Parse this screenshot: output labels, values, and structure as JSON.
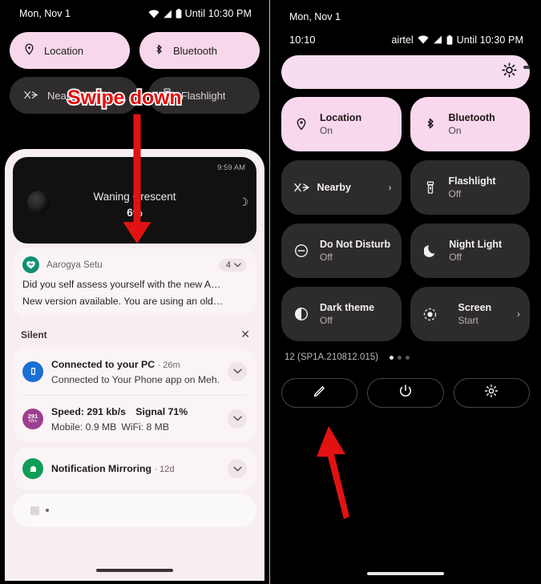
{
  "left_phone": {
    "statusbar": {
      "date": "Mon, Nov 1",
      "battery_text": "Until 10:30 PM",
      "icons": [
        "wifi-icon",
        "signal-icon",
        "battery-icon"
      ]
    },
    "quick_tiles": [
      {
        "label": "Location",
        "state": "on",
        "icon": "location-pin-icon"
      },
      {
        "label": "Bluetooth",
        "state": "on",
        "icon": "bluetooth-icon"
      },
      {
        "label": "Nearby Shar..",
        "state": "off",
        "icon": "nearby-share-icon",
        "chevron": "›"
      },
      {
        "label": "Flashlight",
        "state": "off",
        "icon": "flashlight-icon"
      }
    ],
    "moon_widget": {
      "time": "9:59 AM",
      "title": "Waning Crescent",
      "percent": "6%",
      "phase_glyph": "☽"
    },
    "notification_aarogya": {
      "app": "Aarogya Setu",
      "count": "4",
      "chevron": "⌄",
      "line1": "Did you self assess yourself with the new A…",
      "line2": "New version available. You are using an old…"
    },
    "silent_header": {
      "label": "Silent",
      "close": "✕"
    },
    "silent_rows": [
      {
        "title": "Connected to your PC",
        "time": "· 26m",
        "subtitle": "Connected to Your Phone app on Meh..",
        "icon": "phone-link-icon",
        "icon_color": "#1a6fd4",
        "chevron": "⌄"
      },
      {
        "title": "Speed: 291 kb/s Signal 71%",
        "time": "",
        "subtitle": "Mobile: 0.9 MB WiFi: 8 MB",
        "icon": "speed-meter-icon",
        "icon_color": "#9c3f8f",
        "icon_text": "291",
        "chevron": "⌄"
      },
      {
        "title": "Notification Mirroring",
        "time": "· 12d",
        "subtitle": "",
        "icon": "mirroring-icon",
        "icon_color": "#0f9d58",
        "chevron": "⌄"
      }
    ],
    "annotation": {
      "text": "Swipe down",
      "arrow": "down-arrow-annotation",
      "color": "#e21212"
    }
  },
  "right_phone": {
    "statusbar": {
      "date": "Mon, Nov 1",
      "clock": "10:10",
      "carrier": "airtel",
      "battery_text": "Until 10:30 PM"
    },
    "brightness": {
      "name": "brightness-slider",
      "icon": "brightness-sun-icon",
      "level_percent": 96
    },
    "tiles": [
      {
        "label": "Location",
        "state_label": "On",
        "state": "on",
        "icon": "location-pin-icon"
      },
      {
        "label": "Bluetooth",
        "state_label": "On",
        "state": "on",
        "icon": "bluetooth-icon"
      },
      {
        "label": "Nearby",
        "state_label": "",
        "state": "off",
        "icon": "nearby-share-icon",
        "chevron": "›",
        "centered": true
      },
      {
        "label": "Flashlight",
        "state_label": "Off",
        "state": "off",
        "icon": "flashlight-icon"
      },
      {
        "label": "Do Not Disturb",
        "state_label": "Off",
        "state": "off",
        "icon": "do-not-disturb-icon"
      },
      {
        "label": "Night Light",
        "state_label": "Off",
        "state": "off",
        "icon": "moon-icon"
      },
      {
        "label": "Dark theme",
        "state_label": "Off",
        "state": "off",
        "icon": "contrast-icon"
      },
      {
        "label": "Screen",
        "state_label": "Start",
        "state": "off",
        "icon": "screen-record-icon",
        "chevron": "›",
        "centered": true
      }
    ],
    "build": "12 (SP1A.210812.015)",
    "page_dots": {
      "total": 3,
      "active_index": 0
    },
    "footer_buttons": [
      {
        "name": "edit-tiles-button",
        "icon": "pencil-icon"
      },
      {
        "name": "power-button",
        "icon": "power-icon"
      },
      {
        "name": "settings-button",
        "icon": "gear-icon"
      }
    ],
    "annotation": {
      "arrow": "up-left-arrow-annotation",
      "color": "#e21212"
    }
  }
}
